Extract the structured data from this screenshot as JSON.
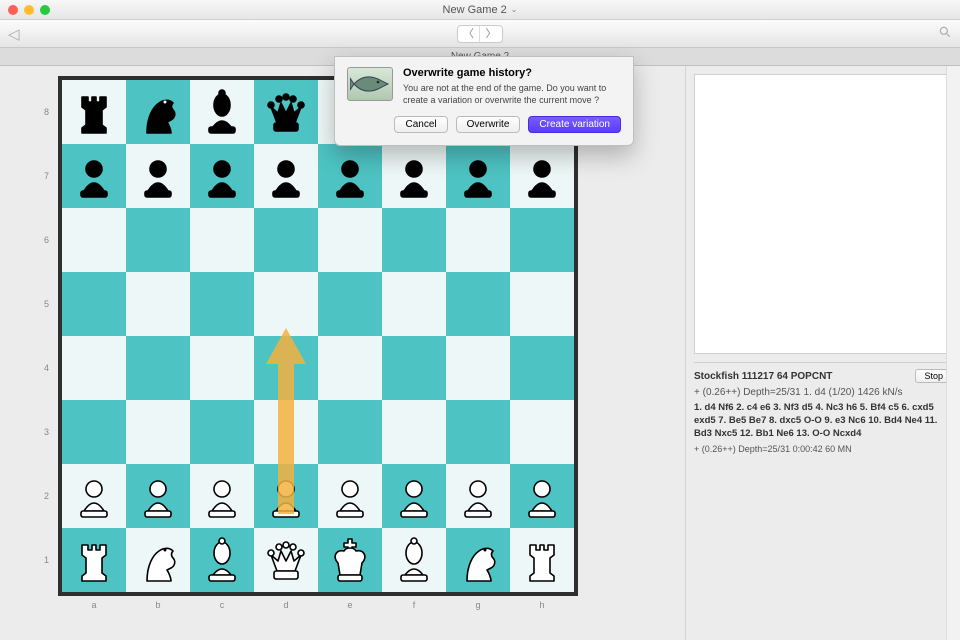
{
  "window": {
    "title": "New Game 2",
    "tab_title": "New Game 2"
  },
  "dialog": {
    "title": "Overwrite game history?",
    "message": "You are not at the end of the game. Do you want to create a variation or overwrite the current move ?",
    "cancel_label": "Cancel",
    "overwrite_label": "Overwrite",
    "variation_label": "Create variation"
  },
  "engine": {
    "name": "Stockfish 111217 64 POPCNT",
    "stop_label": "Stop",
    "summary": "+ (0.26++)    Depth=25/31    1. d4 (1/20)    1426 kN/s",
    "pv": "1. d4 Nf6 2. c4 e6 3. Nf3 d5 4. Nc3 h6 5. Bf4 c5 6. cxd5 exd5 7. Be5 Be7 8. dxc5 O-O 9. e3 Nc6 10. Bd4 Ne4 11. Bd3 Nxc5 12. Bb1 Ne6 13. O-O Ncxd4",
    "stats": "+ (0.26++)    Depth=25/31    0:00:42    60 MN"
  },
  "board": {
    "files": [
      "a",
      "b",
      "c",
      "d",
      "e",
      "f",
      "g",
      "h"
    ],
    "ranks": [
      "8",
      "7",
      "6",
      "5",
      "4",
      "3",
      "2",
      "1"
    ],
    "arrow": {
      "from": "d2",
      "to": "d4"
    },
    "position_fen_ranks": [
      "rnbqkbnr",
      "pppppppp",
      "8",
      "8",
      "8",
      "8",
      "PPPPPPPP",
      "RNBQKBNR"
    ],
    "light_color": "#eef7f7",
    "dark_color": "#4ec3c3"
  }
}
